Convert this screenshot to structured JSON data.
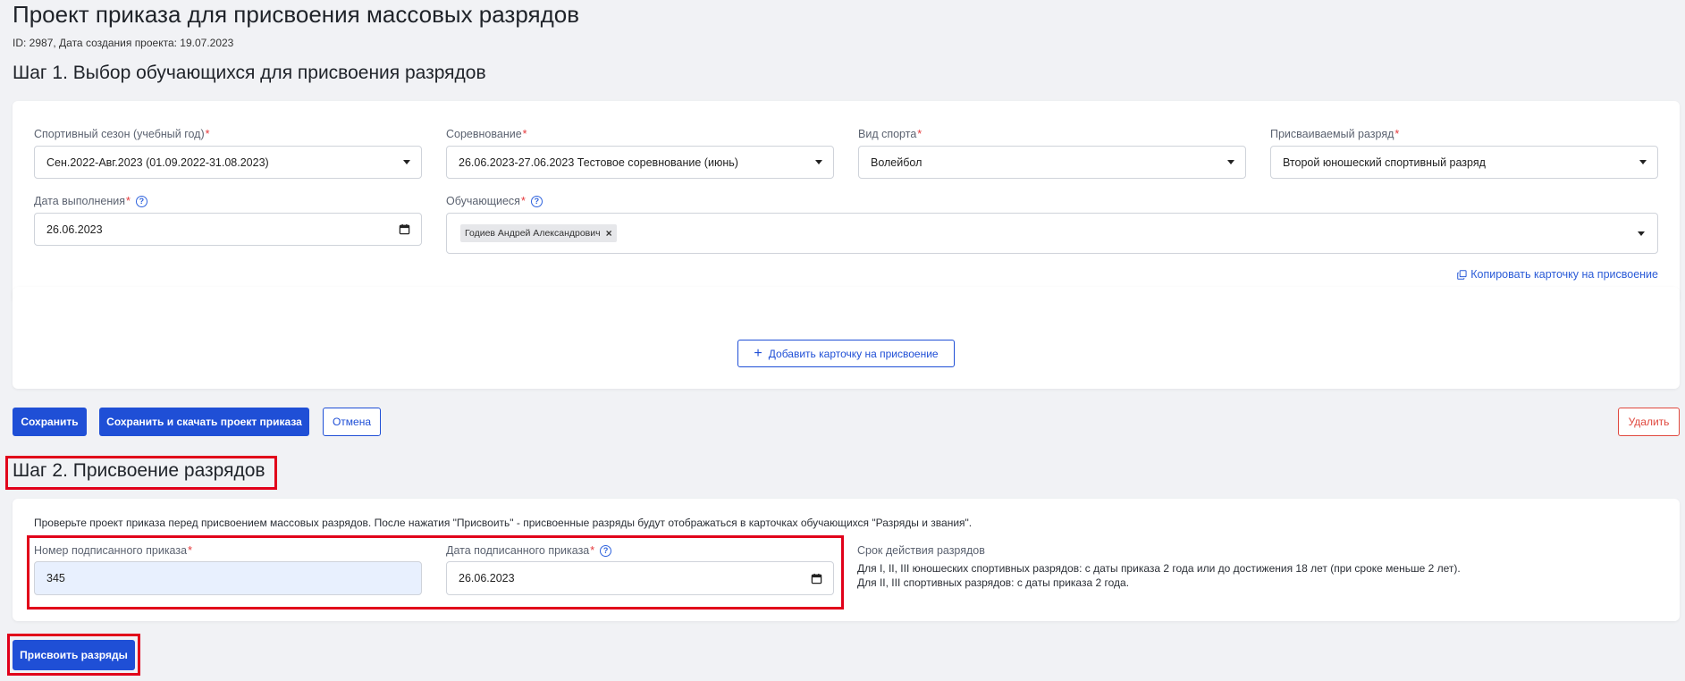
{
  "page": {
    "title": "Проект приказа для присвоения массовых разрядов",
    "meta": "ID: 2987, Дата создания проекта: 19.07.2023"
  },
  "glyphs": {
    "required": "*",
    "help": "?",
    "plus": "+",
    "remove": "×"
  },
  "icons": {
    "dropdown": "caret-down-icon",
    "calendar": "calendar-icon",
    "help": "help-circle-icon",
    "copy": "copy-icon",
    "plus": "plus-icon",
    "remove": "close-icon"
  },
  "step1": {
    "heading": "Шаг 1. Выбор обучающихся для присвоения разрядов",
    "fields": {
      "season": {
        "label": "Спортивный сезон (учебный год)",
        "value": "Сен.2022-Авг.2023 (01.09.2022-31.08.2023)"
      },
      "competition": {
        "label": "Соревнование",
        "value": "26.06.2023-27.06.2023 Тестовое соревнование (июнь)"
      },
      "sport": {
        "label": "Вид спорта",
        "value": "Волейбол"
      },
      "rank": {
        "label": "Присваиваемый разряд",
        "value": "Второй юношеский спортивный разряд"
      },
      "completion_date": {
        "label": "Дата выполнения",
        "value": "26.06.2023"
      }
    },
    "students": {
      "label": "Обучающиеся",
      "selected": [
        {
          "name": "Годиев Андрей Александрович"
        }
      ]
    },
    "copy_link": "Копировать карточку на присвоение",
    "add_card_button": "Добавить карточку на присвоение"
  },
  "actions": {
    "save": "Сохранить",
    "save_download": "Сохранить и скачать проект приказа",
    "cancel": "Отмена",
    "delete": "Удалить"
  },
  "step2": {
    "heading": "Шаг 2. Присвоение разрядов",
    "notice": "Проверьте проект приказа перед присвоением массовых разрядов. После нажатия \"Присвоить\" - присвоенные разряды будут отображаться в карточках обучающихся \"Разряды и звания\".",
    "order_number": {
      "label": "Номер подписанного приказа",
      "value": "345"
    },
    "order_date": {
      "label": "Дата подписанного приказа",
      "value": "26.06.2023"
    },
    "validity": {
      "title": "Срок действия разрядов",
      "lines": [
        "Для I, II, III юношеских спортивных разрядов: с даты приказа 2 года или до достижения 18 лет (при сроке меньше 2 лет).",
        "Для II, III спортивных разрядов: с даты приказа 2 года."
      ]
    },
    "assign_button": "Присвоить разряды"
  },
  "colors": {
    "primary": "#1f4fd6",
    "danger": "#e0483e",
    "required": "#e5383b",
    "highlight": "#e1001a",
    "background": "#f1f2f5",
    "autofill": "#e8f0fe"
  }
}
